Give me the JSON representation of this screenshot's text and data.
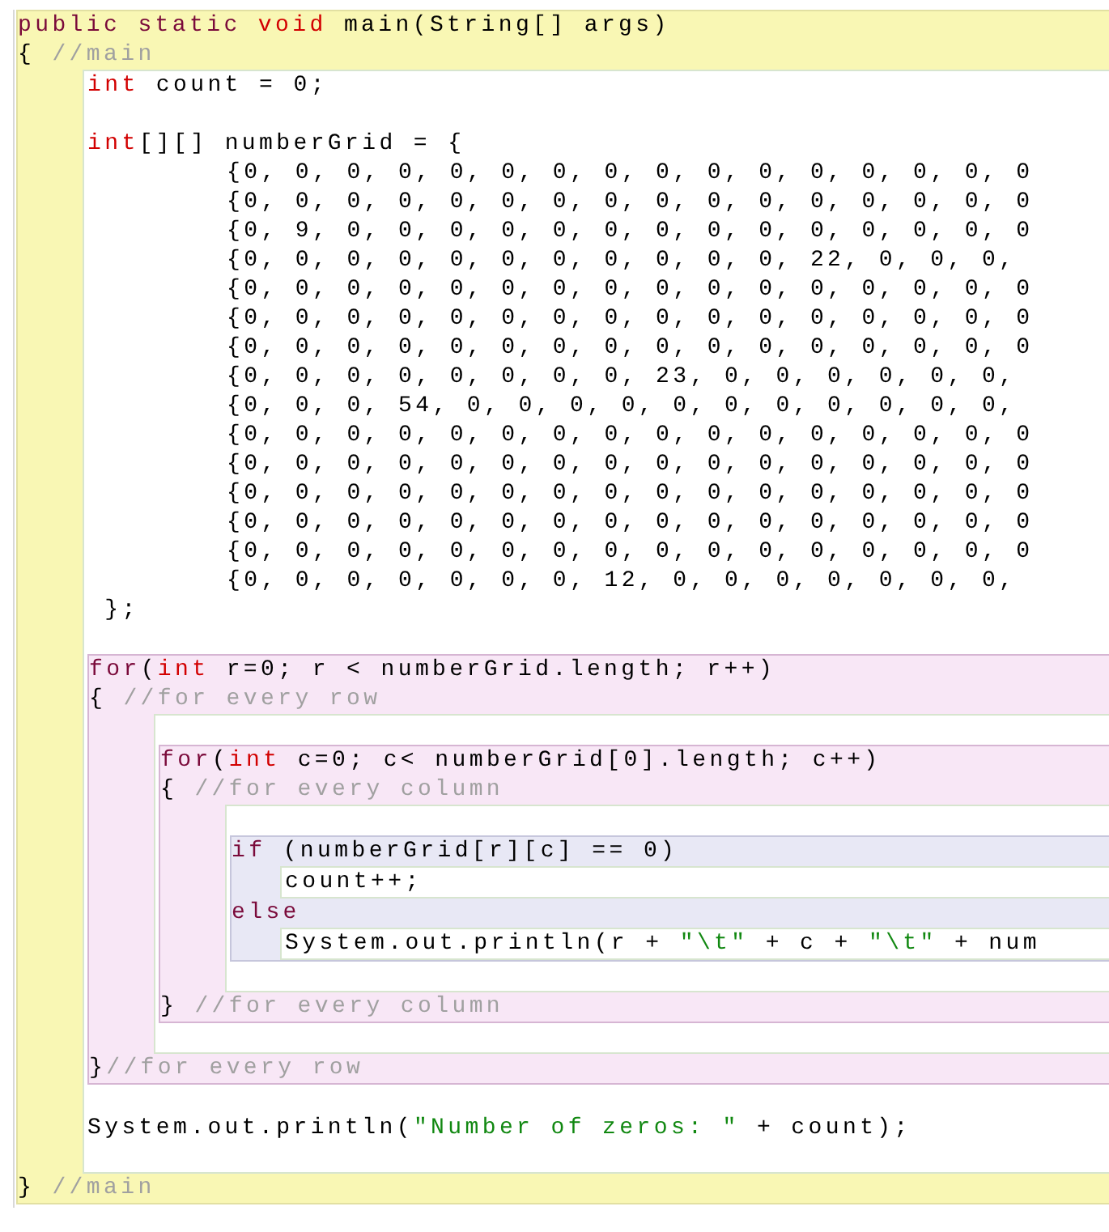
{
  "editor": {
    "scope": {
      "kind": "method",
      "sections": [
        {
          "header": [
            [
              {
                "text": "public static ",
                "kind": "keyword"
              },
              {
                "text": "void ",
                "kind": "type"
              },
              {
                "text": "main(String[] args)",
                "kind": "plain"
              }
            ],
            [
              {
                "text": "{ ",
                "kind": "plain"
              },
              {
                "text": "//main",
                "kind": "comment"
              }
            ]
          ],
          "body": [
            {
              "kind": "line",
              "tokens": [
                {
                  "text": "int ",
                  "kind": "type"
                },
                {
                  "text": "count = 0;",
                  "kind": "plain"
                }
              ]
            },
            {
              "kind": "blank"
            },
            {
              "kind": "line",
              "tokens": [
                {
                  "text": "int",
                  "kind": "type"
                },
                {
                  "text": "[][] numberGrid = {",
                  "kind": "plain"
                }
              ],
              "children": [
                {
                  "kind": "line",
                  "tokens": [
                    {
                      "text": "{0, 0, 0, 0, 0, 0, 0, 0, 0, 0, 0, 0, 0, 0, 0, 0",
                      "kind": "plain"
                    }
                  ]
                },
                {
                  "kind": "line",
                  "tokens": [
                    {
                      "text": "{0, 0, 0, 0, 0, 0, 0, 0, 0, 0, 0, 0, 0, 0, 0, 0",
                      "kind": "plain"
                    }
                  ]
                },
                {
                  "kind": "line",
                  "tokens": [
                    {
                      "text": "{0, 9, 0, 0, 0, 0, 0, 0, 0, 0, 0, 0, 0, 0, 0, 0",
                      "kind": "plain"
                    }
                  ]
                },
                {
                  "kind": "line",
                  "tokens": [
                    {
                      "text": "{0, 0, 0, 0, 0, 0, 0, 0, 0, 0, 0, 22, 0, 0, 0,",
                      "kind": "plain"
                    }
                  ]
                },
                {
                  "kind": "line",
                  "tokens": [
                    {
                      "text": "{0, 0, 0, 0, 0, 0, 0, 0, 0, 0, 0, 0, 0, 0, 0, 0",
                      "kind": "plain"
                    }
                  ]
                },
                {
                  "kind": "line",
                  "tokens": [
                    {
                      "text": "{0, 0, 0, 0, 0, 0, 0, 0, 0, 0, 0, 0, 0, 0, 0, 0",
                      "kind": "plain"
                    }
                  ]
                },
                {
                  "kind": "line",
                  "tokens": [
                    {
                      "text": "{0, 0, 0, 0, 0, 0, 0, 0, 0, 0, 0, 0, 0, 0, 0, 0",
                      "kind": "plain"
                    }
                  ]
                },
                {
                  "kind": "line",
                  "tokens": [
                    {
                      "text": "{0, 0, 0, 0, 0, 0, 0, 0, 23, 0, 0, 0, 0, 0, 0,",
                      "kind": "plain"
                    }
                  ]
                },
                {
                  "kind": "line",
                  "tokens": [
                    {
                      "text": "{0, 0, 0, 54, 0, 0, 0, 0, 0, 0, 0, 0, 0, 0, 0,",
                      "kind": "plain"
                    }
                  ]
                },
                {
                  "kind": "line",
                  "tokens": [
                    {
                      "text": "{0, 0, 0, 0, 0, 0, 0, 0, 0, 0, 0, 0, 0, 0, 0, 0",
                      "kind": "plain"
                    }
                  ]
                },
                {
                  "kind": "line",
                  "tokens": [
                    {
                      "text": "{0, 0, 0, 0, 0, 0, 0, 0, 0, 0, 0, 0, 0, 0, 0, 0",
                      "kind": "plain"
                    }
                  ]
                },
                {
                  "kind": "line",
                  "tokens": [
                    {
                      "text": "{0, 0, 0, 0, 0, 0, 0, 0, 0, 0, 0, 0, 0, 0, 0, 0",
                      "kind": "plain"
                    }
                  ]
                },
                {
                  "kind": "line",
                  "tokens": [
                    {
                      "text": "{0, 0, 0, 0, 0, 0, 0, 0, 0, 0, 0, 0, 0, 0, 0, 0",
                      "kind": "plain"
                    }
                  ]
                },
                {
                  "kind": "line",
                  "tokens": [
                    {
                      "text": "{0, 0, 0, 0, 0, 0, 0, 0, 0, 0, 0, 0, 0, 0, 0, 0",
                      "kind": "plain"
                    }
                  ]
                },
                {
                  "kind": "line",
                  "tokens": [
                    {
                      "text": "{0, 0, 0, 0, 0, 0, 0, 12, 0, 0, 0, 0, 0, 0, 0,",
                      "kind": "plain"
                    }
                  ]
                }
              ]
            },
            {
              "kind": "line",
              "tokens": [
                {
                  "text": " };",
                  "kind": "plain"
                }
              ]
            },
            {
              "kind": "blank"
            },
            {
              "kind": "loop",
              "sections": [
                {
                  "header": [
                    [
                      {
                        "text": "for",
                        "kind": "keyword"
                      },
                      {
                        "text": "(",
                        "kind": "plain"
                      },
                      {
                        "text": "int ",
                        "kind": "type"
                      },
                      {
                        "text": "r=0; r < numberGrid.length; r++)",
                        "kind": "plain"
                      }
                    ],
                    [
                      {
                        "text": "{ ",
                        "kind": "plain"
                      },
                      {
                        "text": "//for every row",
                        "kind": "comment"
                      }
                    ]
                  ],
                  "body": [
                    {
                      "kind": "blank"
                    },
                    {
                      "kind": "loop",
                      "sections": [
                        {
                          "header": [
                            [
                              {
                                "text": "for",
                                "kind": "keyword"
                              },
                              {
                                "text": "(",
                                "kind": "plain"
                              },
                              {
                                "text": "int ",
                                "kind": "type"
                              },
                              {
                                "text": "c=0; c< numberGrid[0].length; c++)",
                                "kind": "plain"
                              }
                            ],
                            [
                              {
                                "text": "{ ",
                                "kind": "plain"
                              },
                              {
                                "text": "//for every column",
                                "kind": "comment"
                              }
                            ]
                          ],
                          "body": [
                            {
                              "kind": "blank"
                            },
                            {
                              "kind": "branch",
                              "sections": [
                                {
                                  "header": [
                                    [
                                      {
                                        "text": "if ",
                                        "kind": "keyword"
                                      },
                                      {
                                        "text": "(numberGrid[r][c] == 0)",
                                        "kind": "plain"
                                      }
                                    ]
                                  ],
                                  "body": [
                                    {
                                      "kind": "line",
                                      "tokens": [
                                        {
                                          "text": "count++;",
                                          "kind": "plain"
                                        }
                                      ]
                                    }
                                  ]
                                },
                                {
                                  "header": [
                                    [
                                      {
                                        "text": "else",
                                        "kind": "keyword"
                                      }
                                    ]
                                  ],
                                  "body": [
                                    {
                                      "kind": "line",
                                      "tokens": [
                                        {
                                          "text": "System.out.println(r + ",
                                          "kind": "plain"
                                        },
                                        {
                                          "text": "\"\\t\"",
                                          "kind": "string"
                                        },
                                        {
                                          "text": " + c + ",
                                          "kind": "plain"
                                        },
                                        {
                                          "text": "\"\\t\"",
                                          "kind": "string"
                                        },
                                        {
                                          "text": " + num",
                                          "kind": "plain"
                                        }
                                      ]
                                    }
                                  ]
                                }
                              ]
                            },
                            {
                              "kind": "blank"
                            }
                          ]
                        }
                      ],
                      "footer": [
                        [
                          {
                            "text": "} ",
                            "kind": "plain"
                          },
                          {
                            "text": "//for every column",
                            "kind": "comment"
                          }
                        ]
                      ]
                    },
                    {
                      "kind": "blank"
                    }
                  ]
                }
              ],
              "footer": [
                [
                  {
                    "text": "}",
                    "kind": "plain"
                  },
                  {
                    "text": "//for every row",
                    "kind": "comment"
                  }
                ]
              ]
            },
            {
              "kind": "blank"
            },
            {
              "kind": "line",
              "tokens": [
                {
                  "text": "System.out.println(",
                  "kind": "plain"
                },
                {
                  "text": "\"Number of zeros: \"",
                  "kind": "string"
                },
                {
                  "text": " + count);",
                  "kind": "plain"
                }
              ]
            },
            {
              "kind": "blank"
            }
          ]
        }
      ],
      "footer": [
        [
          {
            "text": "} ",
            "kind": "plain"
          },
          {
            "text": "//main",
            "kind": "comment"
          }
        ]
      ]
    }
  }
}
